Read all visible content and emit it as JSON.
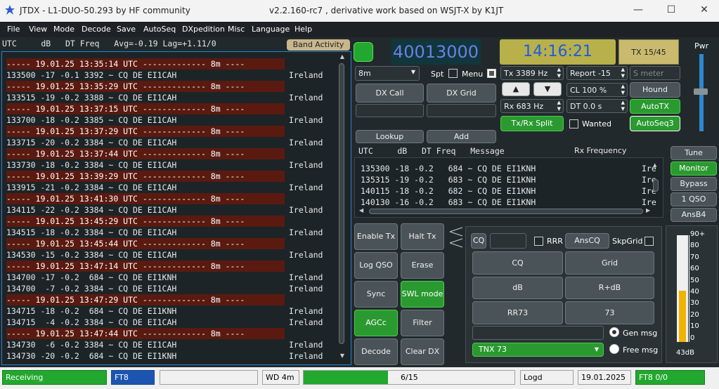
{
  "window": {
    "title": "JTDX - L1-DUO-50.293  by HF community",
    "subtitle": "v2.2.160-rc7 , derivative work based on WSJT-X by K1JT",
    "controls": [
      "—",
      "☐",
      "✕"
    ]
  },
  "menu": [
    "File",
    "View",
    "Mode",
    "Decode",
    "Save",
    "AutoSeq",
    "DXpedition",
    "Misc",
    "Language",
    "Help"
  ],
  "band_header": {
    "text": "UTC     dB   DT Freq   Avg=-0.19 Lag=+1.11/0",
    "band_activity_label": "Band Activity"
  },
  "band_rows": [
    {
      "t": "----- 19.01.25 13:35:14 UTC ------------- 8m ----",
      "sep": true,
      "c": ""
    },
    {
      "t": "133500 -17 -0.1 3392 ~ CQ DE EI1CAH",
      "sep": false,
      "c": "Ireland"
    },
    {
      "t": "----- 19.01.25 13:35:29 UTC ------------- 8m ----",
      "sep": true,
      "c": ""
    },
    {
      "t": "133515 -19 -0.2 3388 ~ CQ DE EI1CAH",
      "sep": false,
      "c": "Ireland"
    },
    {
      "t": "----- 19.01.25 13:37:15 UTC ------------- 8m ----",
      "sep": true,
      "c": ""
    },
    {
      "t": "133700 -18 -0.2 3385 ~ CQ DE EI1CAH",
      "sep": false,
      "c": "Ireland"
    },
    {
      "t": "----- 19.01.25 13:37:29 UTC ------------- 8m ----",
      "sep": true,
      "c": ""
    },
    {
      "t": "133715 -20 -0.2 3384 ~ CQ DE EI1CAH",
      "sep": false,
      "c": "Ireland"
    },
    {
      "t": "----- 19.01.25 13:37:44 UTC ------------- 8m ----",
      "sep": true,
      "c": ""
    },
    {
      "t": "133730 -18 -0.2 3384 ~ CQ DE EI1CAH",
      "sep": false,
      "c": "Ireland"
    },
    {
      "t": "----- 19.01.25 13:39:29 UTC ------------- 8m ----",
      "sep": true,
      "c": ""
    },
    {
      "t": "133915 -21 -0.2 3384 ~ CQ DE EI1CAH",
      "sep": false,
      "c": "Ireland"
    },
    {
      "t": "----- 19.01.25 13:41:30 UTC ------------- 8m ----",
      "sep": true,
      "c": ""
    },
    {
      "t": "134115 -22 -0.2 3384 ~ CQ DE EI1CAH",
      "sep": false,
      "c": "Ireland"
    },
    {
      "t": "----- 19.01.25 13:45:29 UTC ------------- 8m ----",
      "sep": true,
      "c": ""
    },
    {
      "t": "134515 -18 -0.2 3384 ~ CQ DE EI1CAH",
      "sep": false,
      "c": "Ireland"
    },
    {
      "t": "----- 19.01.25 13:45:44 UTC ------------- 8m ----",
      "sep": true,
      "c": ""
    },
    {
      "t": "134530 -15 -0.2 3384 ~ CQ DE EI1CAH",
      "sep": false,
      "c": "Ireland"
    },
    {
      "t": "----- 19.01.25 13:47:14 UTC ------------- 8m ----",
      "sep": true,
      "c": ""
    },
    {
      "t": "134700 -17 -0.2  684 ~ CQ DE EI1KNH",
      "sep": false,
      "c": "Ireland"
    },
    {
      "t": "134700  -7 -0.2 3384 ~ CQ DE EI1CAH",
      "sep": false,
      "c": "Ireland"
    },
    {
      "t": "----- 19.01.25 13:47:29 UTC ------------- 8m ----",
      "sep": true,
      "c": ""
    },
    {
      "t": "134715 -18 -0.2  684 ~ CQ DE EI1KNH",
      "sep": false,
      "c": "Ireland"
    },
    {
      "t": "134715  -4 -0.2 3384 ~ CQ DE EI1CAH",
      "sep": false,
      "c": "Ireland"
    },
    {
      "t": "----- 19.01.25 13:47:44 UTC ------------- 8m ----",
      "sep": true,
      "c": ""
    },
    {
      "t": "134730  -6 -0.2 3384 ~ CQ DE EI1CAH",
      "sep": false,
      "c": "Ireland"
    },
    {
      "t": "134730 -20 -0.2  684 ~ CQ DE EI1KNH",
      "sep": false,
      "c": "Ireland"
    }
  ],
  "freq": "40013000",
  "clock": "14:16:21",
  "tx_button": "TX 15/45",
  "band_select": "8m",
  "spt_label": "Spt",
  "menu_label": "Menu",
  "tx_freq": "Tx  3389  Hz",
  "rx_freq": "Rx  683  Hz",
  "report": "Report -15",
  "smeter_placeholder": "S meter",
  "cl": "CL  100 %",
  "dt": "DT 0.0 s",
  "buttons": {
    "dx_call": "DX Call",
    "dx_grid": "DX Grid",
    "lookup": "Lookup",
    "add": "Add",
    "hound": "Hound",
    "autotx": "AutoTX",
    "txrx_split": "Tx/Rx Split",
    "wanted": "Wanted",
    "autoseq3": "AutoSeq3",
    "up": "▲",
    "down": "▼"
  },
  "rx_header": "UTC     dB   DT Freq   Message",
  "rx_freq_header": "Rx Frequency",
  "rx_rows": [
    "135300 -18 -0.2   684 ~ CQ DE EI1KNH",
    "135315 -19 -0.2   683 ~ CQ DE EI1KNH",
    "140115 -18 -0.2   682 ~ CQ DE EI1KNH",
    "140130 -16 -0.2   683 ~ CQ DE EI1KNH"
  ],
  "rx_country_stub": "Ire",
  "side_buttons": [
    "Tune",
    "Monitor",
    "Bypass",
    "1 QSO",
    "AnsB4"
  ],
  "ctrl_buttons": {
    "enable_tx": "Enable Tx",
    "halt_tx": "Halt Tx",
    "log_qso": "Log QSO",
    "erase": "Erase",
    "sync": "Sync",
    "swl_mode": "SWL mode",
    "agcc": "AGCc",
    "filter": "Filter",
    "decode": "Decode",
    "clear_dx": "Clear DX"
  },
  "msg_panel": {
    "cq": "CQ",
    "rrr": "RRR",
    "anscq": "AnsCQ",
    "skpgrid": "SkpGrid",
    "cq_btn": "CQ",
    "grid_btn": "Grid",
    "db_btn": "dB",
    "rdb_btn": "R+dB",
    "rr73_btn": "RR73",
    "b73_btn": "73",
    "gen_msg": "Gen msg",
    "free_msg": "Free msg",
    "free_text": "TNX 73"
  },
  "pwr_label": "Pwr",
  "vu_ticks": [
    "90+",
    "80",
    "70",
    "60",
    "50",
    "40",
    "30",
    "20",
    "10",
    "0"
  ],
  "vu_level_db": 43,
  "vu_readout": "43dB",
  "status": {
    "receiving": "Receiving",
    "mode": "FT8",
    "wd": "WD 4m",
    "progress_text": "6/15",
    "progress_fraction": 0.4,
    "logd": "Logd",
    "date": "19.01.2025",
    "mode_qso": "FT8  0/0"
  },
  "colors": {
    "accent_green": "#2a9a30",
    "separator_red": "#5a1a10",
    "freq_text": "#6d7fe6",
    "clock_bg": "#b8b04a"
  }
}
